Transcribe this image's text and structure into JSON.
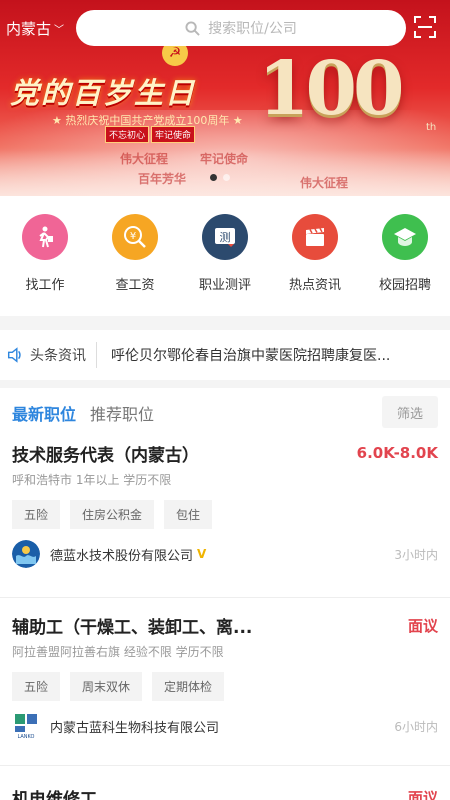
{
  "location": {
    "city": "内蒙古"
  },
  "search": {
    "placeholder": "搜索职位/公司"
  },
  "banner": {
    "headline": "党的百岁生日",
    "subline": "★ 热烈庆祝中国共产党成立100周年 ★",
    "seal": [
      "不忘初心",
      "牢记使命"
    ],
    "number": "100",
    "number_suffix": "th",
    "deco": [
      "伟大征程",
      "百年芳华",
      "牢记使命",
      "伟大征程"
    ],
    "pager": {
      "count": 2,
      "active": 1
    }
  },
  "quick_links": [
    {
      "label": "找工作",
      "icon": "walking-person-icon",
      "color": "#f06596"
    },
    {
      "label": "查工资",
      "icon": "yuan-search-icon",
      "color": "#f6a623"
    },
    {
      "label": "职业测评",
      "icon": "assessment-icon",
      "color": "#2c4a6e"
    },
    {
      "label": "热点资讯",
      "icon": "clapperboard-icon",
      "color": "#e74c3c"
    },
    {
      "label": "校园招聘",
      "icon": "graduation-cap-icon",
      "color": "#3fbf4f"
    }
  ],
  "news": {
    "tag": "头条资讯",
    "text": "呼伦贝尔鄂伦春自治旗中蒙医院招聘康复医..."
  },
  "jobs_section": {
    "tabs": [
      "最新职位",
      "推荐职位"
    ],
    "active_tab": 0,
    "filter_label": "筛选",
    "accent": "#2e86de",
    "salary_color": "#e2444e"
  },
  "jobs": [
    {
      "title": "技术服务代表（内蒙古）",
      "salary": "6.0K-8.0K",
      "meta": "呼和浩特市 1年以上 学历不限",
      "tags": [
        "五险",
        "住房公积金",
        "包住"
      ],
      "company": "德蓝水技术股份有限公司",
      "verified_mark": "V",
      "time": "3小时内"
    },
    {
      "title": "辅助工（干燥工、装卸工、离...",
      "salary": "面议",
      "meta": "阿拉善盟阿拉善右旗 经验不限 学历不限",
      "tags": [
        "五险",
        "周末双休",
        "定期体检"
      ],
      "company": "内蒙古蓝科生物科技有限公司",
      "logo_text": "LANKO",
      "time": "6小时内"
    },
    {
      "title": "机电维修工",
      "salary": "面议"
    }
  ]
}
